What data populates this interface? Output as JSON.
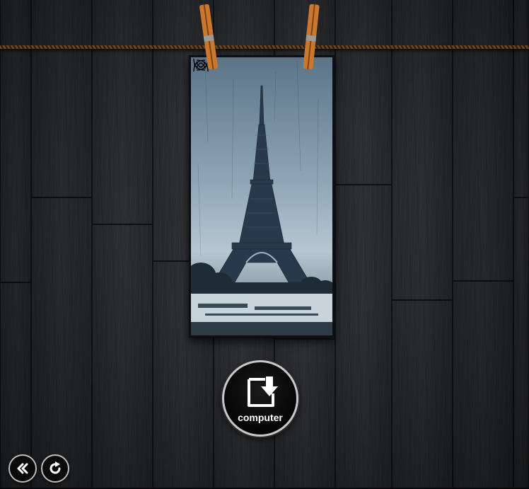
{
  "scene": {
    "photo_subject": "Eiffel Tower",
    "icons": {
      "download": "download-to-computer-icon",
      "back": "double-chevron-left-icon",
      "refresh": "refresh-icon"
    },
    "colors": {
      "button_ring": "#c8c8c8",
      "button_fill": "#050505",
      "label": "#ffffff",
      "rope": "#6a4522",
      "clip_wood": "#c9782e"
    }
  },
  "actions": {
    "download_label": "computer"
  }
}
